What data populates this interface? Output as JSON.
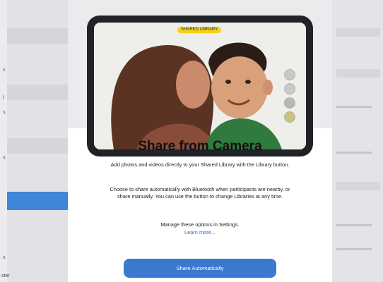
{
  "background": {
    "left_glyphs": [
      "s",
      "j",
      "s",
      "s",
      "s"
    ],
    "bottom_text": "ster"
  },
  "camera": {
    "badge": "SHARED LIBRARY"
  },
  "sheet": {
    "title": "Share from Camera",
    "paragraph_1": "Add photos and videos directly to your Shared Library with the Library button.",
    "paragraph_2": "Choose to share automatically with Bluetooth when participants are nearby, or share manually. You can use the button to change Libraries at any time.",
    "paragraph_3": "Manage these options in Settings.",
    "learn_more": "Learn more...",
    "primary_button": "Share Automatically"
  },
  "colors": {
    "accent": "#3b78cf",
    "link": "#2a6fd6",
    "badge": "#f4d21b"
  }
}
